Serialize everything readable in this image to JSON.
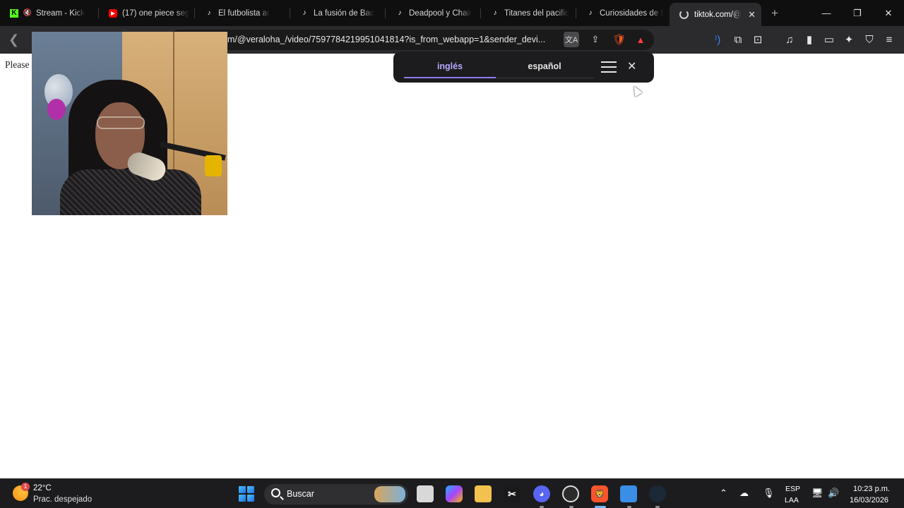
{
  "tabs": [
    {
      "title": "Stream - Kick",
      "favicon": "kick-icon",
      "color": "#53fc18"
    },
    {
      "title": "(17) one piece seg",
      "favicon": "youtube-icon",
      "color": "#ff0000"
    },
    {
      "title": "El futbolista ar",
      "favicon": "tiktok-icon",
      "color": "#ffffff"
    },
    {
      "title": "La fusión de Bad",
      "favicon": "tiktok-icon",
      "color": "#ffffff"
    },
    {
      "title": "Deadpool y Chair",
      "favicon": "tiktok-icon",
      "color": "#ffffff"
    },
    {
      "title": "Titanes del pacific",
      "favicon": "tiktok-icon",
      "color": "#ffffff"
    },
    {
      "title": "Curiosidades de S",
      "favicon": "tiktok-icon",
      "color": "#ffffff"
    }
  ],
  "active_tab": {
    "title": "tiktok.com/@",
    "close": "✕"
  },
  "new_tab": "+",
  "window_controls": {
    "minimize": "—",
    "maximize": "❐",
    "close": "✕"
  },
  "url": {
    "text": "m/@veraloha_/video/7597784219951041814?is_from_webapp=1&sender_devi..."
  },
  "page": {
    "text": "Please"
  },
  "translate_popup": {
    "source_lang": "inglés",
    "target_lang": "español"
  },
  "taskbar": {
    "weather_temp": "22°C",
    "weather_desc": "Prac. despejado",
    "weather_badge": "1",
    "search_label": "Buscar",
    "lang_line1": "ESP",
    "lang_line2": "LAA",
    "time": "10:23 p.m.",
    "date": "16/03/2026"
  }
}
